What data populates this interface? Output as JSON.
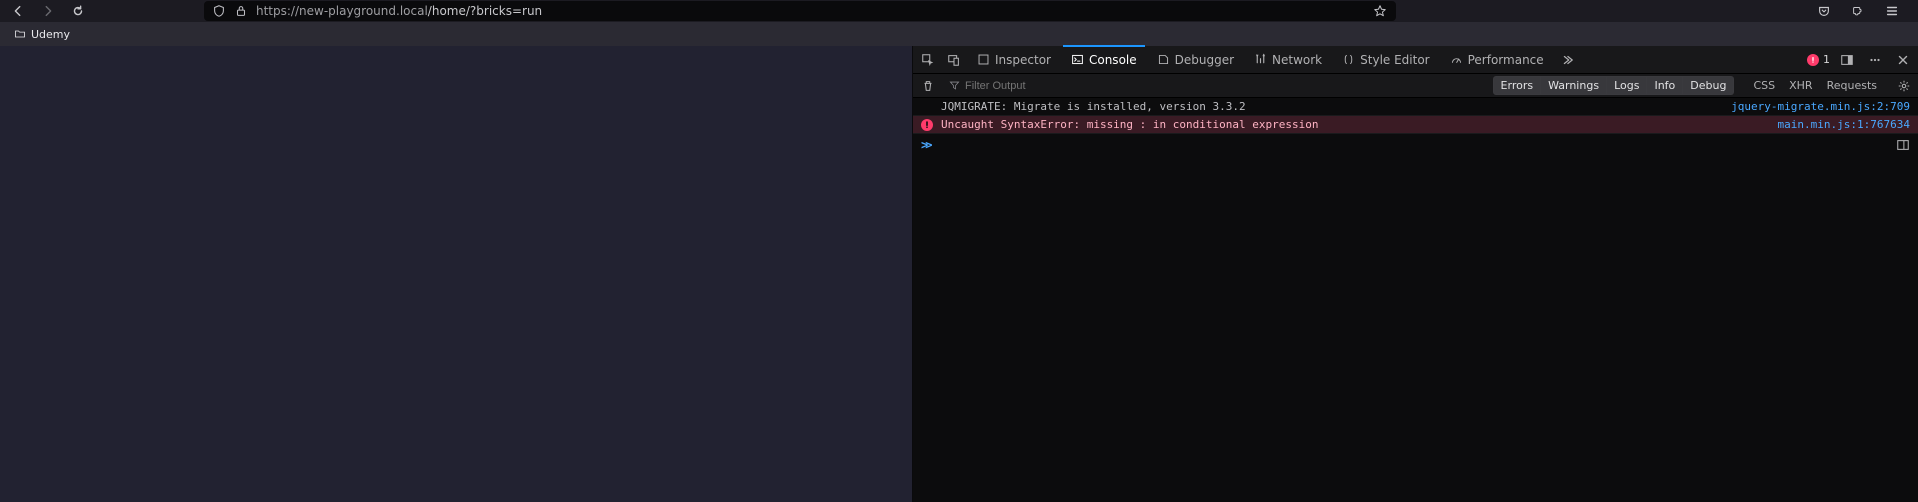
{
  "browser": {
    "url_host": "https://new-playground.local",
    "url_path": "/home/?bricks=run"
  },
  "bookmarks": {
    "items": [
      {
        "label": "Udemy"
      }
    ]
  },
  "devtools": {
    "tabs": {
      "inspector": "Inspector",
      "console": "Console",
      "debugger": "Debugger",
      "network": "Network",
      "style_editor": "Style Editor",
      "performance": "Performance"
    },
    "error_count": "1",
    "filter_placeholder": "Filter Output",
    "toggles_a": {
      "errors": "Errors",
      "warnings": "Warnings",
      "logs": "Logs",
      "info": "Info",
      "debug": "Debug"
    },
    "toggles_b": {
      "css": "CSS",
      "xhr": "XHR",
      "requests": "Requests"
    },
    "messages": [
      {
        "type": "log",
        "text": "JQMIGRATE: Migrate is installed, version 3.3.2",
        "source": "jquery-migrate.min.js:2:709"
      },
      {
        "type": "error",
        "text": "Uncaught SyntaxError: missing : in conditional expression",
        "source": "main.min.js:1:767634"
      }
    ]
  }
}
